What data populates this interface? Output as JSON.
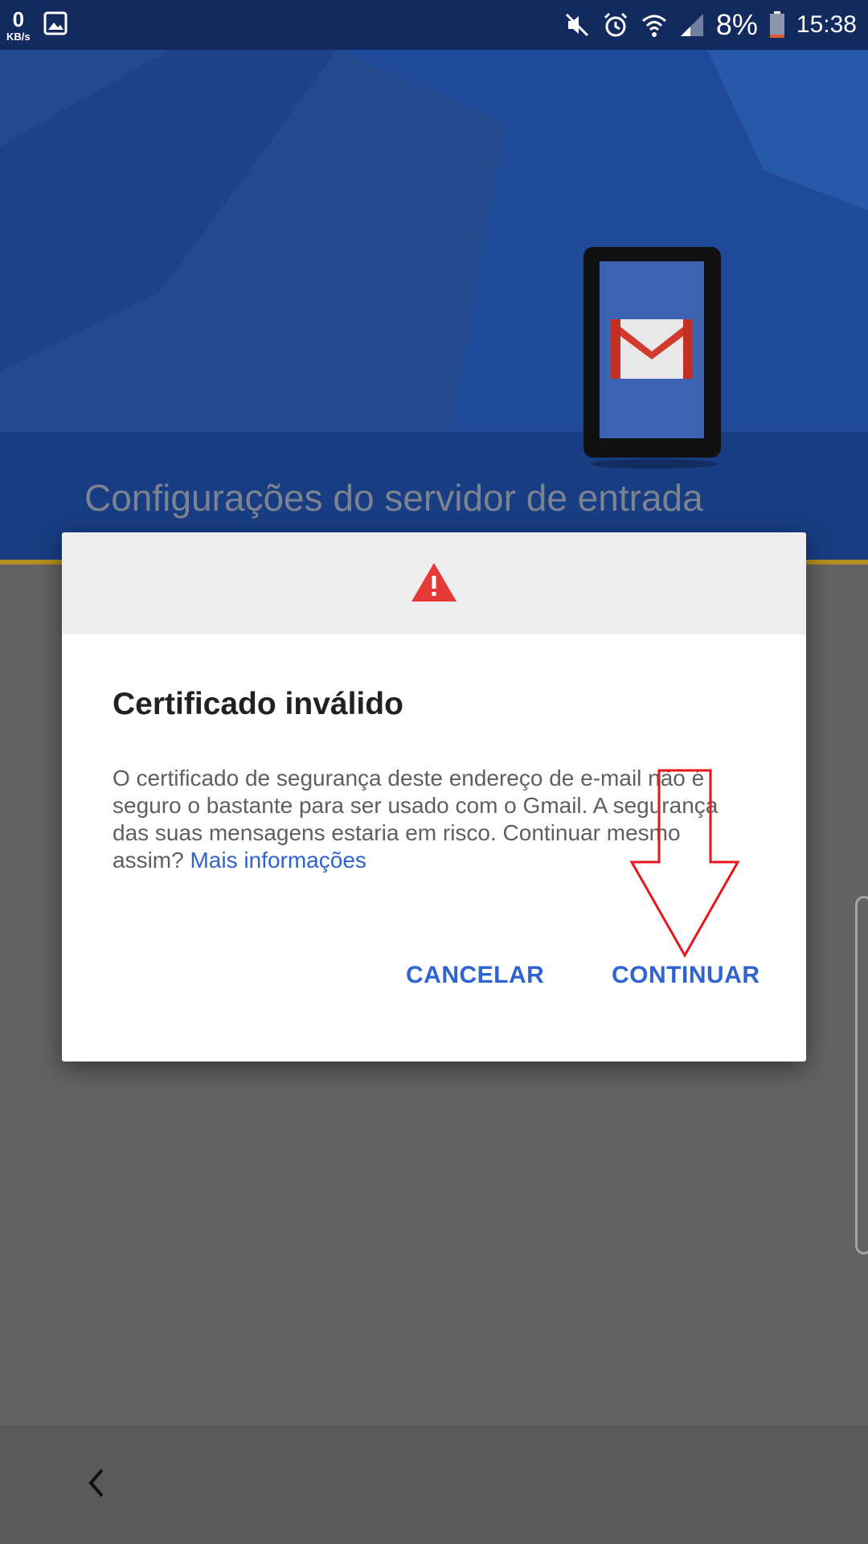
{
  "status_bar": {
    "net_speed_value": "0",
    "net_speed_unit": "KB/s",
    "battery_percent": "8%",
    "time": "15:38",
    "icons": [
      "image-icon",
      "mute-icon",
      "alarm-icon",
      "wifi-icon",
      "signal-icon",
      "battery-icon"
    ]
  },
  "header": {
    "title": "Configurações do servidor de entrada",
    "illustration": "gmail-device-icon",
    "colors": {
      "background": "#1f4a9a",
      "accent": "#b48f21"
    }
  },
  "dialog": {
    "icon": "warning-icon",
    "title": "Certificado inválido",
    "message": "O certificado de segurança deste endereço de e-mail não é seguro o bastante para ser usado com o Gmail. A segurança das suas mensagens estaria em risco. Continuar mesmo assim?",
    "link_text": "Mais informações",
    "cancel_label": "CANCELAR",
    "continue_label": "CONTINUAR",
    "colors": {
      "button": "#2f63d2",
      "warning": "#e53935"
    }
  },
  "annotation": {
    "icon": "red-arrow-down-icon",
    "color": "#e8161c"
  },
  "navbar": {
    "back_icon": "back-chevron-icon"
  }
}
